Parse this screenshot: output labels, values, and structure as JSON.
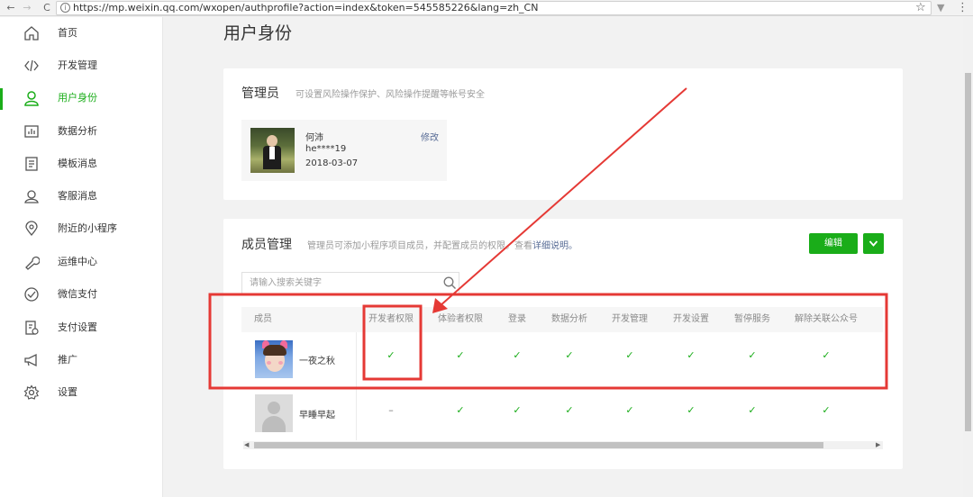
{
  "browser": {
    "url": "https://mp.weixin.qq.com/wxopen/authprofile?action=index&token=545585226&lang=zh_CN",
    "back_icon": "←",
    "forward_icon": "→",
    "reload_icon": "C",
    "info_icon": "i",
    "star_icon": "☆",
    "menu_icon": "⋮"
  },
  "sidebar": {
    "items": [
      {
        "label": "首页",
        "icon": "home-icon"
      },
      {
        "label": "开发管理",
        "icon": "code-icon"
      },
      {
        "label": "用户身份",
        "icon": "user-icon",
        "active": true
      },
      {
        "label": "数据分析",
        "icon": "chart-icon"
      },
      {
        "label": "模板消息",
        "icon": "template-icon"
      },
      {
        "label": "客服消息",
        "icon": "service-icon"
      },
      {
        "label": "附近的小程序",
        "icon": "location-icon"
      },
      {
        "label": "运维中心",
        "icon": "wrench-icon"
      },
      {
        "label": "微信支付",
        "icon": "pay-icon"
      },
      {
        "label": "支付设置",
        "icon": "pay-settings-icon"
      },
      {
        "label": "推广",
        "icon": "megaphone-icon"
      },
      {
        "label": "设置",
        "icon": "gear-icon"
      }
    ],
    "accent": "#1aad19"
  },
  "main": {
    "page_title": "用户身份",
    "admin_card": {
      "title": "管理员",
      "description": "可设置风险操作保护、风险操作提醒等帐号安全",
      "admin": {
        "name": "何沛",
        "account": "he****19",
        "date": "2018-03-07",
        "edit_label": "修改"
      }
    },
    "member_card": {
      "title": "成员管理",
      "description": "管理员可添加小程序项目成员，并配置成员的权限。查看",
      "description_link": "详细说明。",
      "edit_button": "编辑",
      "search_placeholder": "请输入搜索关键字",
      "columns": [
        "成员",
        "开发者权限",
        "体验者权限",
        "登录",
        "数据分析",
        "开发管理",
        "开发设置",
        "暂停服务",
        "解除关联公众号"
      ],
      "rows": [
        {
          "name": "一夜之秋",
          "cells": [
            "✓",
            "✓",
            "✓",
            "✓",
            "✓",
            "✓",
            "✓",
            "✓"
          ]
        },
        {
          "name": "早睡早起",
          "cells": [
            "–",
            "✓",
            "✓",
            "✓",
            "✓",
            "✓",
            "✓",
            "✓"
          ]
        }
      ]
    }
  },
  "colors": {
    "green": "#1aad19",
    "link": "#576b95",
    "annotation_red": "#e53935"
  }
}
